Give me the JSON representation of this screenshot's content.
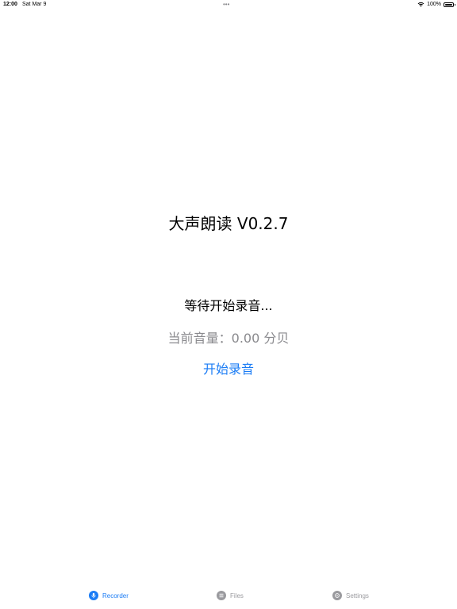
{
  "status_bar": {
    "time": "12:00",
    "date": "Sat Mar 9",
    "dots": "•••",
    "battery": "100%"
  },
  "main": {
    "title": "大声朗读 V0.2.7",
    "status": "等待开始录音...",
    "volume": "当前音量：0.00 分贝",
    "start_button": "开始录音"
  },
  "tab_bar": {
    "tabs": [
      {
        "label": "Recorder",
        "icon": "microphone-icon",
        "active": true
      },
      {
        "label": "Files",
        "icon": "list-icon",
        "active": false
      },
      {
        "label": "Settings",
        "icon": "gear-icon",
        "active": false
      }
    ]
  },
  "colors": {
    "accent": "#1a7cf5",
    "inactive": "#9a9a9e",
    "secondary_text": "#8a8a8e"
  }
}
